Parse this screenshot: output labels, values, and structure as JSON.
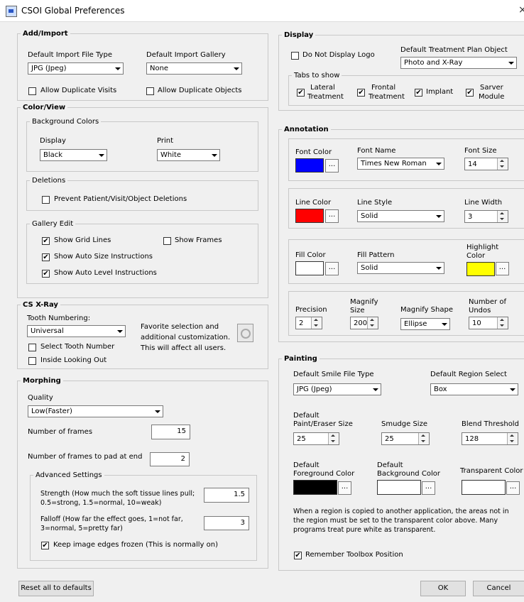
{
  "window": {
    "title": "CSOI Global Preferences",
    "close": "×"
  },
  "add_import": {
    "legend": "Add/Import",
    "file_type_label": "Default Import File Type",
    "file_type_value": "JPG (Jpeg)",
    "gallery_label": "Default Import Gallery",
    "gallery_value": "None",
    "allow_dup_visits": "Allow Duplicate  Visits",
    "allow_dup_objects": "Allow Duplicate Objects"
  },
  "color_view": {
    "legend": "Color/View",
    "bg_legend": "Background Colors",
    "display_label": "Display",
    "display_value": "Black",
    "print_label": "Print",
    "print_value": "White",
    "deletions_legend": "Deletions",
    "prevent_deletions": "Prevent Patient/Visit/Object Deletions",
    "gallery_legend": "Gallery Edit",
    "show_grid": "Show Grid Lines",
    "show_frames": "Show Frames",
    "auto_size": "Show Auto Size Instructions",
    "auto_level": "Show Auto Level Instructions"
  },
  "xray": {
    "legend": "CS X-Ray",
    "tooth_label": "Tooth Numbering:",
    "tooth_value": "Universal",
    "fav_text1": "Favorite selection and",
    "fav_text2": "additional customization.",
    "fav_text3": "This will affect all users.",
    "select_tooth": "Select Tooth Number",
    "inside_out": "Inside Looking Out"
  },
  "morphing": {
    "legend": "Morphing",
    "quality_label": "Quality",
    "quality_value": "Low(Faster)",
    "frames_label": "Number of frames",
    "frames_value": "15",
    "pad_label": "Number of frames to pad at end",
    "pad_value": "2",
    "adv_legend": "Advanced Settings",
    "strength_l1": "Strength (How much the soft tissue lines pull;",
    "strength_l2": "0.5=strong, 1.5=normal, 10=weak)",
    "strength_value": "1.5",
    "falloff_l1": "Falloff (How far the effect goes, 1=not far,",
    "falloff_l2": "3=normal, 5=pretty far)",
    "falloff_value": "3",
    "keep_edges": "Keep image edges frozen  (This is normally on)"
  },
  "display": {
    "legend": "Display",
    "no_logo": "Do Not Display Logo",
    "plan_label": "Default Treatment Plan Object",
    "plan_value": "Photo and X-Ray",
    "tabs_legend": "Tabs to show",
    "lateral_1": "Lateral",
    "lateral_2": "Treatment",
    "frontal_1": "Frontal",
    "frontal_2": "Treatment",
    "implant": "Implant",
    "sarver_1": "Sarver",
    "sarver_2": "Module"
  },
  "annotation": {
    "legend": "Annotation",
    "font_color_label": "Font Color",
    "font_name_label": "Font Name",
    "font_name_value": "Times New Roman",
    "font_size_label": "Font Size",
    "font_size_value": "14",
    "line_color_label": "Line Color",
    "line_style_label": "Line Style",
    "line_style_value": "Solid",
    "line_width_label": "Line Width",
    "line_width_value": "3",
    "fill_color_label": "Fill Color",
    "fill_pattern_label": "Fill Pattern",
    "fill_pattern_value": "Solid",
    "highlight_l1": "Highlight",
    "highlight_l2": "Color",
    "precision_label": "Precision",
    "precision_value": "2",
    "magnify_size_l1": "Magnify",
    "magnify_size_l2": "Size",
    "magnify_size_value": "200",
    "magnify_shape_label": "Magnify Shape",
    "magnify_shape_value": "Ellipse",
    "undos_l1": "Number of",
    "undos_l2": "Undos",
    "undos_value": "10",
    "ellipsis": "..."
  },
  "painting": {
    "legend": "Painting",
    "smile_label": "Default Smile File Type",
    "smile_value": "JPG (Jpeg)",
    "region_label": "Default Region Select",
    "region_value": "Box",
    "paint_l1": "Default",
    "paint_l2": "Paint/Eraser Size",
    "paint_value": "25",
    "smudge_label": "Smudge Size",
    "smudge_value": "25",
    "blend_label": "Blend Threshold",
    "blend_value": "128",
    "fg_l1": "Default",
    "fg_l2": "Foreground Color",
    "bg_l1": "Default",
    "bg_l2": "Background Color",
    "transparent_label": "Transparent Color",
    "note_l1": "When a region is copied to another application, the areas not in",
    "note_l2": "the region must be set to the transparent color above. Many",
    "note_l3": "programs treat pure white as transparent.",
    "remember_toolbox": "Remember Toolbox Position"
  },
  "footer": {
    "reset": "Reset all to defaults",
    "ok": "OK",
    "cancel": "Cancel"
  },
  "colors": {
    "font": "#0000ff",
    "line": "#ff0000",
    "fill": "#ffffff",
    "highlight": "#ffff00",
    "foreground": "#000000",
    "background": "#ffffff",
    "transparent": "#ffffff"
  },
  "checks": {
    "mark": "✔"
  }
}
